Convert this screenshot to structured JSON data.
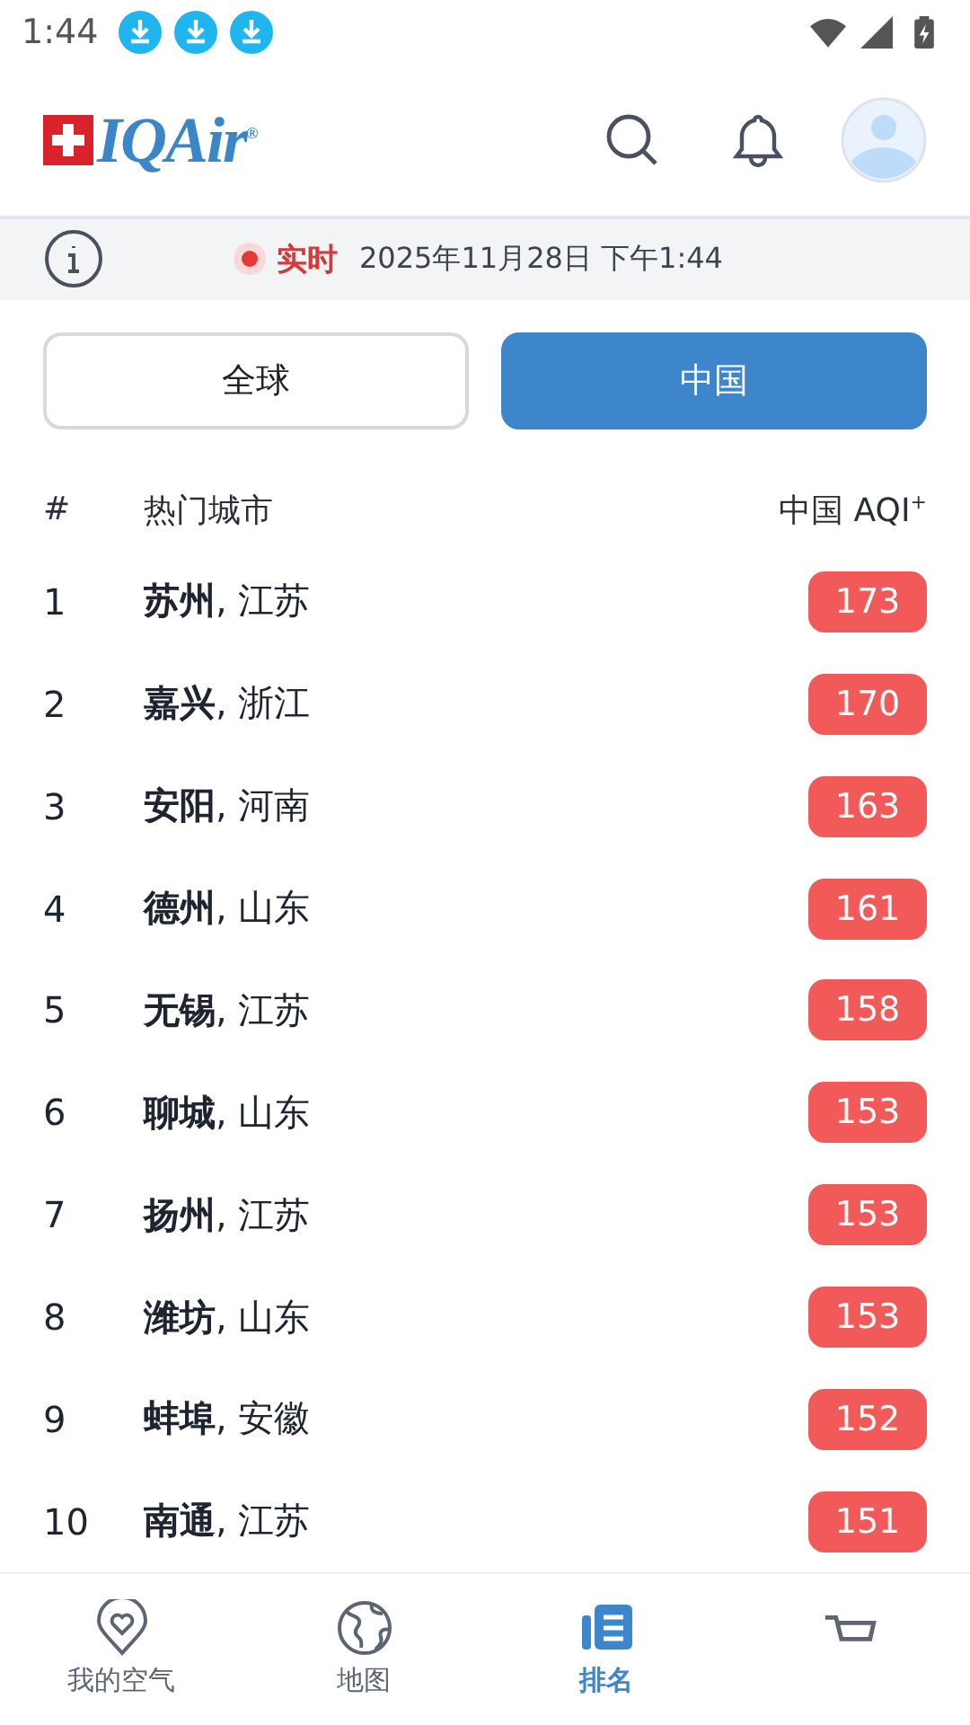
{
  "status_bar": {
    "time": "1:44",
    "notifications": [
      {
        "kind": "download"
      },
      {
        "kind": "download"
      },
      {
        "kind": "download"
      }
    ]
  },
  "header": {
    "logo": "IQAir$^{®}$"
  },
  "info_bar": {
    "live_label": "实时",
    "datetime": "2025年11月28日 下午1:44"
  },
  "scope_tabs": [
    {
      "label": "全球",
      "selected": false
    },
    {
      "label": "中国",
      "selected": true
    }
  ],
  "table": {
    "columns": [
      "#",
      "热门城市",
      "中国 AQI$^{+}$"
    ],
    "rows": [
      {
        "rank": "1",
        "city": "苏州",
        "province": ", 江苏",
        "aqi": "173"
      },
      {
        "rank": "2",
        "city": "嘉兴",
        "province": ", 浙江",
        "aqi": "170"
      },
      {
        "rank": "3",
        "city": "安阳",
        "province": ", 河南",
        "aqi": "163"
      },
      {
        "rank": "4",
        "city": "德州",
        "province": ", 山东",
        "aqi": "161"
      },
      {
        "rank": "5",
        "city": "无锡",
        "province": ", 江苏",
        "aqi": "158"
      },
      {
        "rank": "6",
        "city": "聊城",
        "province": ", 山东",
        "aqi": "153"
      },
      {
        "rank": "7",
        "city": "扬州",
        "province": ", 江苏",
        "aqi": "153"
      },
      {
        "rank": "8",
        "city": "潍坊",
        "province": ", 山东",
        "aqi": "153"
      },
      {
        "rank": "9",
        "city": "蚌埠",
        "province": ", 安徽",
        "aqi": "152"
      },
      {
        "rank": "10",
        "city": "南通",
        "province": ", 江苏",
        "aqi": "151"
      }
    ]
  },
  "bottom_nav": [
    {
      "kind": "heart-pin",
      "label": "我的空气",
      "selected": false
    },
    {
      "kind": "globe",
      "label": "地图",
      "selected": false
    },
    {
      "kind": "ranking",
      "label": "排名",
      "selected": true
    },
    {
      "kind": "cart",
      "selected": false
    }
  ]
}
